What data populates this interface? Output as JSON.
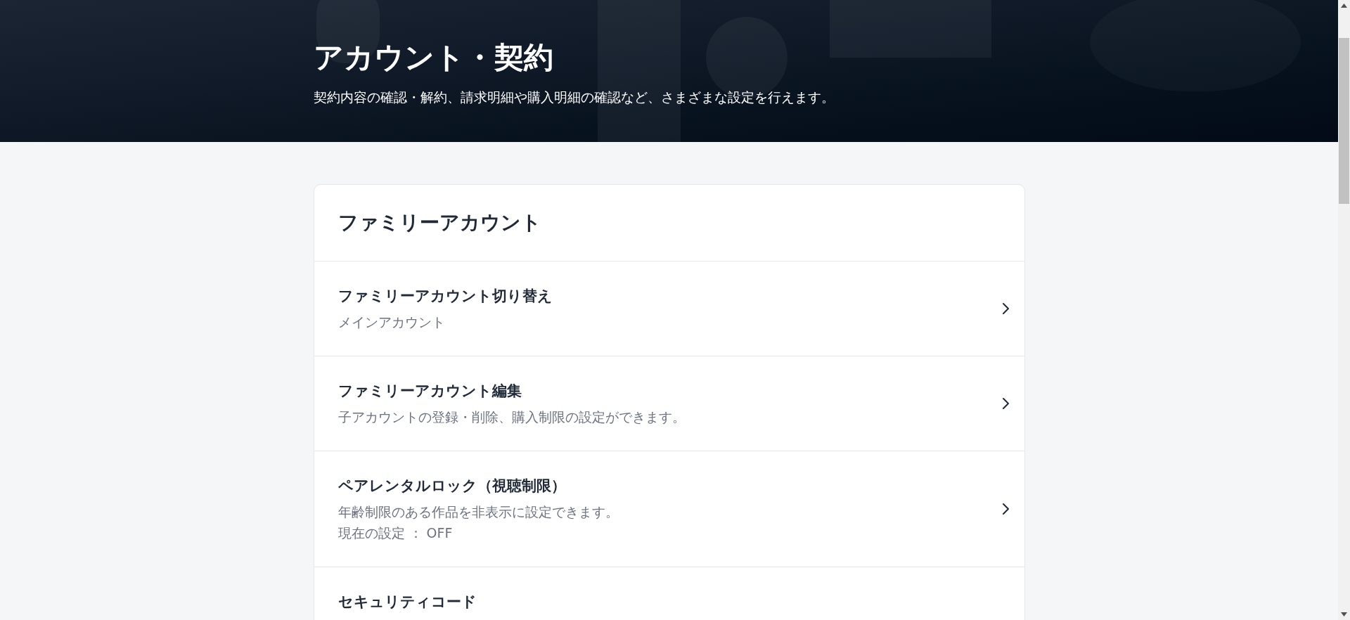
{
  "header": {
    "title": "アカウント・契約",
    "subtitle": "契約内容の確認・解約、請求明細や購入明細の確認など、さまざまな設定を行えます。"
  },
  "card": {
    "title": "ファミリーアカウント",
    "items": [
      {
        "title": "ファミリーアカウント切り替え",
        "lines": [
          "メインアカウント"
        ]
      },
      {
        "title": "ファミリーアカウント編集",
        "lines": [
          "子アカウントの登録・削除、購入制限の設定ができます。"
        ]
      },
      {
        "title": "ペアレンタルロック（視聴制限）",
        "lines": [
          "年齢制限のある作品を非表示に設定できます。",
          "現在の設定 ： OFF"
        ]
      },
      {
        "title": "セキュリティコード"
      }
    ]
  }
}
